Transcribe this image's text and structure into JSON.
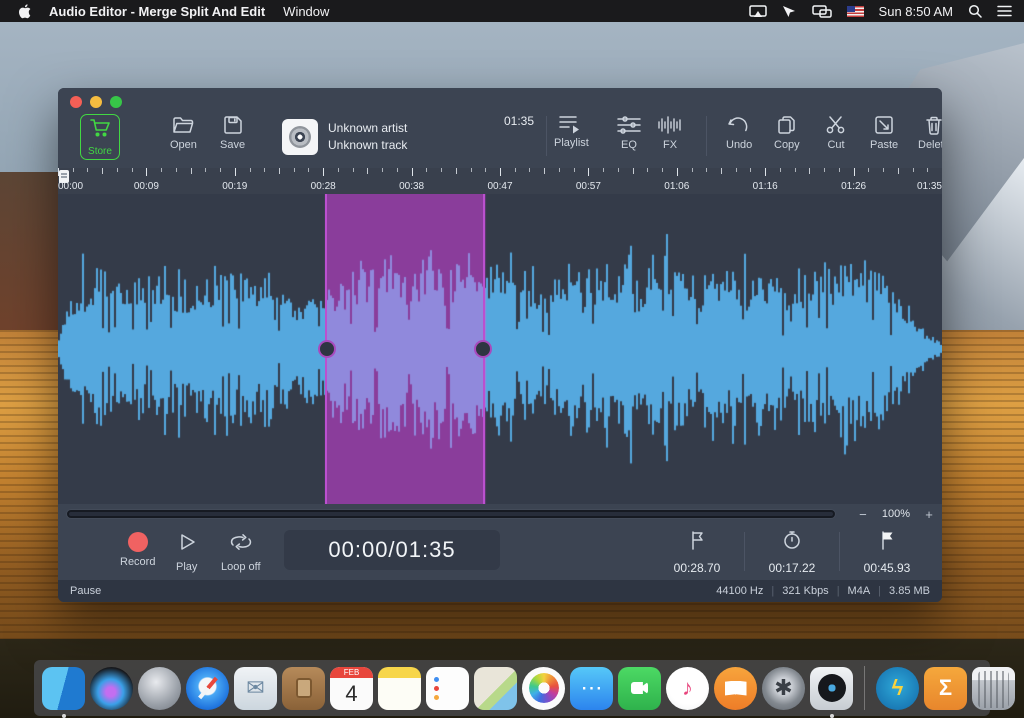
{
  "menubar": {
    "app_name": "Audio Editor - Merge Split And Edit",
    "menus": [
      "Window"
    ],
    "clock": "Sun 8:50 AM"
  },
  "toolbar": {
    "store_label": "Store",
    "open_label": "Open",
    "save_label": "Save",
    "track": {
      "artist": "Unknown artist",
      "title": "Unknown track",
      "duration": "01:35"
    },
    "playlist_label": "Playlist",
    "eq_label": "EQ",
    "fx_label": "FX",
    "undo_label": "Undo",
    "copy_label": "Copy",
    "cut_label": "Cut",
    "paste_label": "Paste",
    "delete_label": "Delete"
  },
  "ruler": {
    "labels": [
      "00:00",
      "00:09",
      "00:19",
      "00:28",
      "00:38",
      "00:47",
      "00:57",
      "01:06",
      "01:16",
      "01:26",
      "01:35"
    ]
  },
  "waveform": {
    "color_outside": "#55a8de",
    "color_inside": "#9089dc",
    "selection_fill": "#8a3d9b",
    "selection_edge": "#bb50cf",
    "background": "#343b49",
    "selection": {
      "start_frac": 0.302,
      "end_frac": 0.4835
    },
    "seed": 1337,
    "envelope": [
      [
        0.0,
        0.08
      ],
      [
        0.015,
        0.42
      ],
      [
        0.05,
        0.5
      ],
      [
        0.08,
        0.4
      ],
      [
        0.105,
        0.48
      ],
      [
        0.13,
        0.36
      ],
      [
        0.16,
        0.46
      ],
      [
        0.19,
        0.56
      ],
      [
        0.22,
        0.46
      ],
      [
        0.25,
        0.4
      ],
      [
        0.27,
        0.24
      ],
      [
        0.285,
        0.44
      ],
      [
        0.3,
        0.3
      ],
      [
        0.32,
        0.5
      ],
      [
        0.36,
        0.56
      ],
      [
        0.4,
        0.5
      ],
      [
        0.44,
        0.58
      ],
      [
        0.47,
        0.54
      ],
      [
        0.485,
        0.48
      ],
      [
        0.51,
        0.55
      ],
      [
        0.54,
        0.48
      ],
      [
        0.57,
        0.52
      ],
      [
        0.6,
        0.5
      ],
      [
        0.63,
        0.56
      ],
      [
        0.66,
        0.48
      ],
      [
        0.7,
        0.52
      ],
      [
        0.73,
        0.5
      ],
      [
        0.76,
        0.56
      ],
      [
        0.8,
        0.52
      ],
      [
        0.83,
        0.48
      ],
      [
        0.86,
        0.55
      ],
      [
        0.89,
        0.62
      ],
      [
        0.92,
        0.5
      ],
      [
        0.95,
        0.34
      ],
      [
        0.97,
        0.16
      ],
      [
        1.0,
        0.04
      ]
    ]
  },
  "zoom": {
    "minus": "−",
    "level": "100%",
    "plus": "+"
  },
  "transport": {
    "record_label": "Record",
    "play_label": "Play",
    "loop_label": "Loop off",
    "time_display": "00:00/01:35",
    "markers": [
      {
        "icon": "flag-outline",
        "time": "00:28.70"
      },
      {
        "icon": "stopwatch",
        "time": "00:17.22"
      },
      {
        "icon": "flag-filled",
        "time": "00:45.93"
      }
    ]
  },
  "statusbar": {
    "state": "Pause",
    "info": [
      "44100 Hz",
      "321 Kbps",
      "M4A",
      "3.85 MB"
    ]
  },
  "dock": {
    "items": [
      {
        "name": "finder",
        "cls": "dk-finder",
        "dot": true
      },
      {
        "name": "siri",
        "cls": "dk-siri round"
      },
      {
        "name": "launchpad",
        "cls": "dk-launchpad round"
      },
      {
        "name": "safari",
        "cls": "dk-safari round"
      },
      {
        "name": "mail",
        "cls": "dk-mail",
        "glyph": "✉"
      },
      {
        "name": "contacts",
        "cls": "dk-contacts"
      },
      {
        "name": "calendar",
        "cls": "dk-calendar",
        "month": "FEB",
        "day": "4"
      },
      {
        "name": "notes",
        "cls": "dk-notes"
      },
      {
        "name": "reminders",
        "cls": "dk-reminders"
      },
      {
        "name": "maps",
        "cls": "dk-maps"
      },
      {
        "name": "photos",
        "cls": "dk-photos round"
      },
      {
        "name": "messages",
        "cls": "dk-messages",
        "glyph": "⋯"
      },
      {
        "name": "facetime",
        "cls": "dk-facetime"
      },
      {
        "name": "itunes",
        "cls": "dk-itunes round",
        "glyph": "♪"
      },
      {
        "name": "ibooks",
        "cls": "dk-ibooks round"
      },
      {
        "name": "system-preferences",
        "cls": "dk-sysprefs round",
        "glyph": "✱"
      },
      {
        "name": "audio-editor",
        "cls": "dk-audioeditor",
        "dot": true
      },
      {
        "name": "divider"
      },
      {
        "name": "lightning-app",
        "cls": "dk-lightning round",
        "glyph": "ϟ"
      },
      {
        "name": "sigma-folder",
        "cls": "dk-sigma",
        "glyph": "Σ"
      },
      {
        "name": "trash",
        "cls": "dk-trash"
      }
    ]
  }
}
